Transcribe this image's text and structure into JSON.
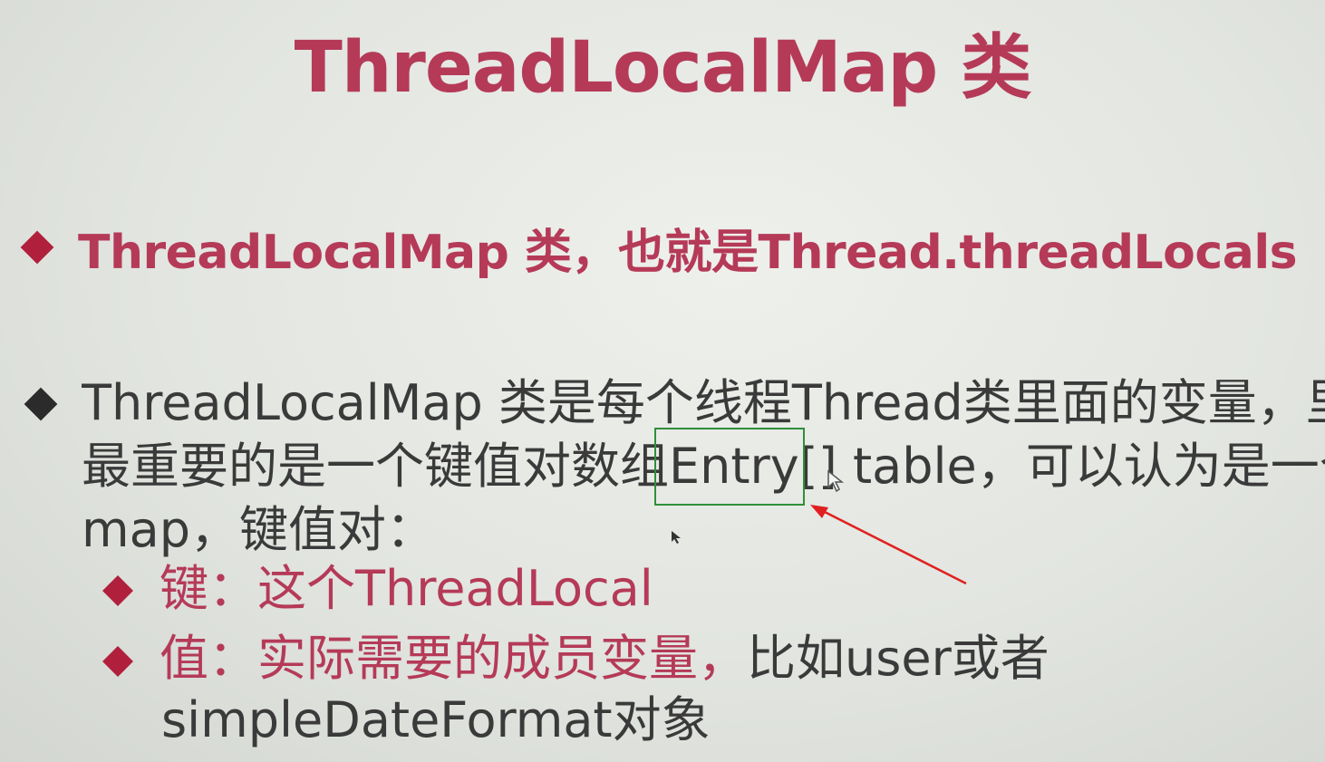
{
  "slide": {
    "title": "ThreadLocalMap 类",
    "bullet1": "ThreadLocalMap 类，也就是Thread.threadLocals",
    "bullet2": {
      "line1": "ThreadLocalMap 类是每个线程Thread类里面的变量，里面",
      "line2": "最重要的是一个键值对数组Entry[] table，可以认为是一个",
      "line3": "map，键值对："
    },
    "sub1": {
      "key": "键：这个ThreadLocal"
    },
    "sub2": {
      "colored": "值：实际需要的成员变量，",
      "plain": "比如user或者",
      "line2": "simpleDateFormat对象"
    }
  },
  "annotation": {
    "box_color": "#2f8f3a",
    "arrow_color": "#e02020"
  },
  "colors": {
    "accent": "#b53a58",
    "text": "#3a3a3a"
  }
}
